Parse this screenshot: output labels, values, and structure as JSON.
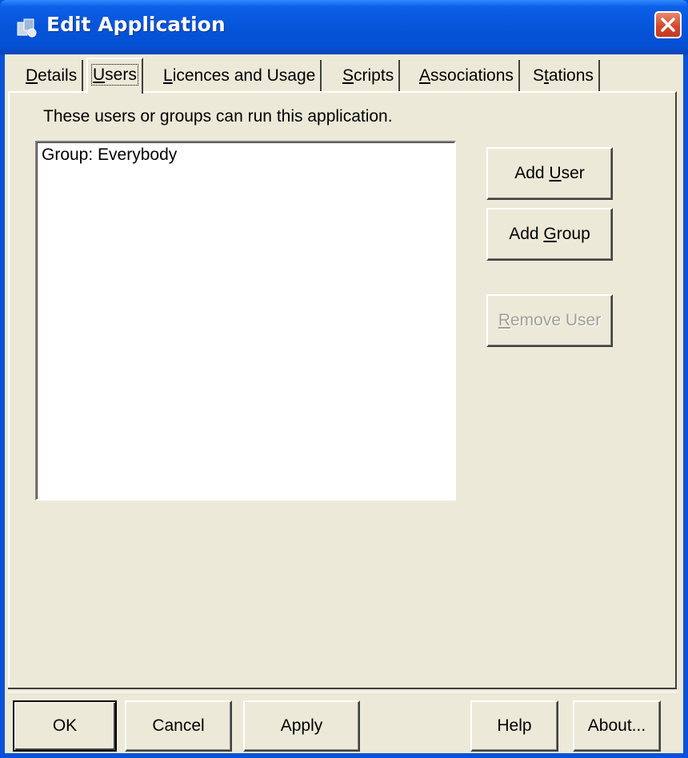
{
  "window": {
    "title": "Edit Application",
    "icon": "application-icon",
    "close_icon": "close-icon",
    "accent_color": "#0550d4"
  },
  "tabs": [
    {
      "label": "Details",
      "hotkey": "D",
      "rest": "etails",
      "active": false
    },
    {
      "label": "Users",
      "hotkey": "U",
      "rest": "sers",
      "active": true
    },
    {
      "label": "Licences and Usage",
      "hotkey": "L",
      "rest": "icences and Usage",
      "active": false
    },
    {
      "label": "Scripts",
      "hotkey": "S",
      "rest": "cripts",
      "active": false
    },
    {
      "label": "Associations",
      "hotkey": "A",
      "rest": "ssociations",
      "active": false
    },
    {
      "label": "Stations",
      "hotkey": "t",
      "pre": "S",
      "rest": "ations",
      "active": false
    }
  ],
  "users_panel": {
    "hint": "These users or groups can run this application.",
    "list_items": [
      "Group: Everybody"
    ],
    "add_user": {
      "pre": "Add ",
      "hotkey": "U",
      "rest": "ser"
    },
    "add_group": {
      "pre": "Add ",
      "hotkey": "G",
      "rest": "roup"
    },
    "remove_user": {
      "pre": "",
      "hotkey": "R",
      "rest": "emove User",
      "disabled": true
    }
  },
  "footer": {
    "ok": "OK",
    "cancel": "Cancel",
    "apply": "Apply",
    "help": "Help",
    "about": "About..."
  }
}
